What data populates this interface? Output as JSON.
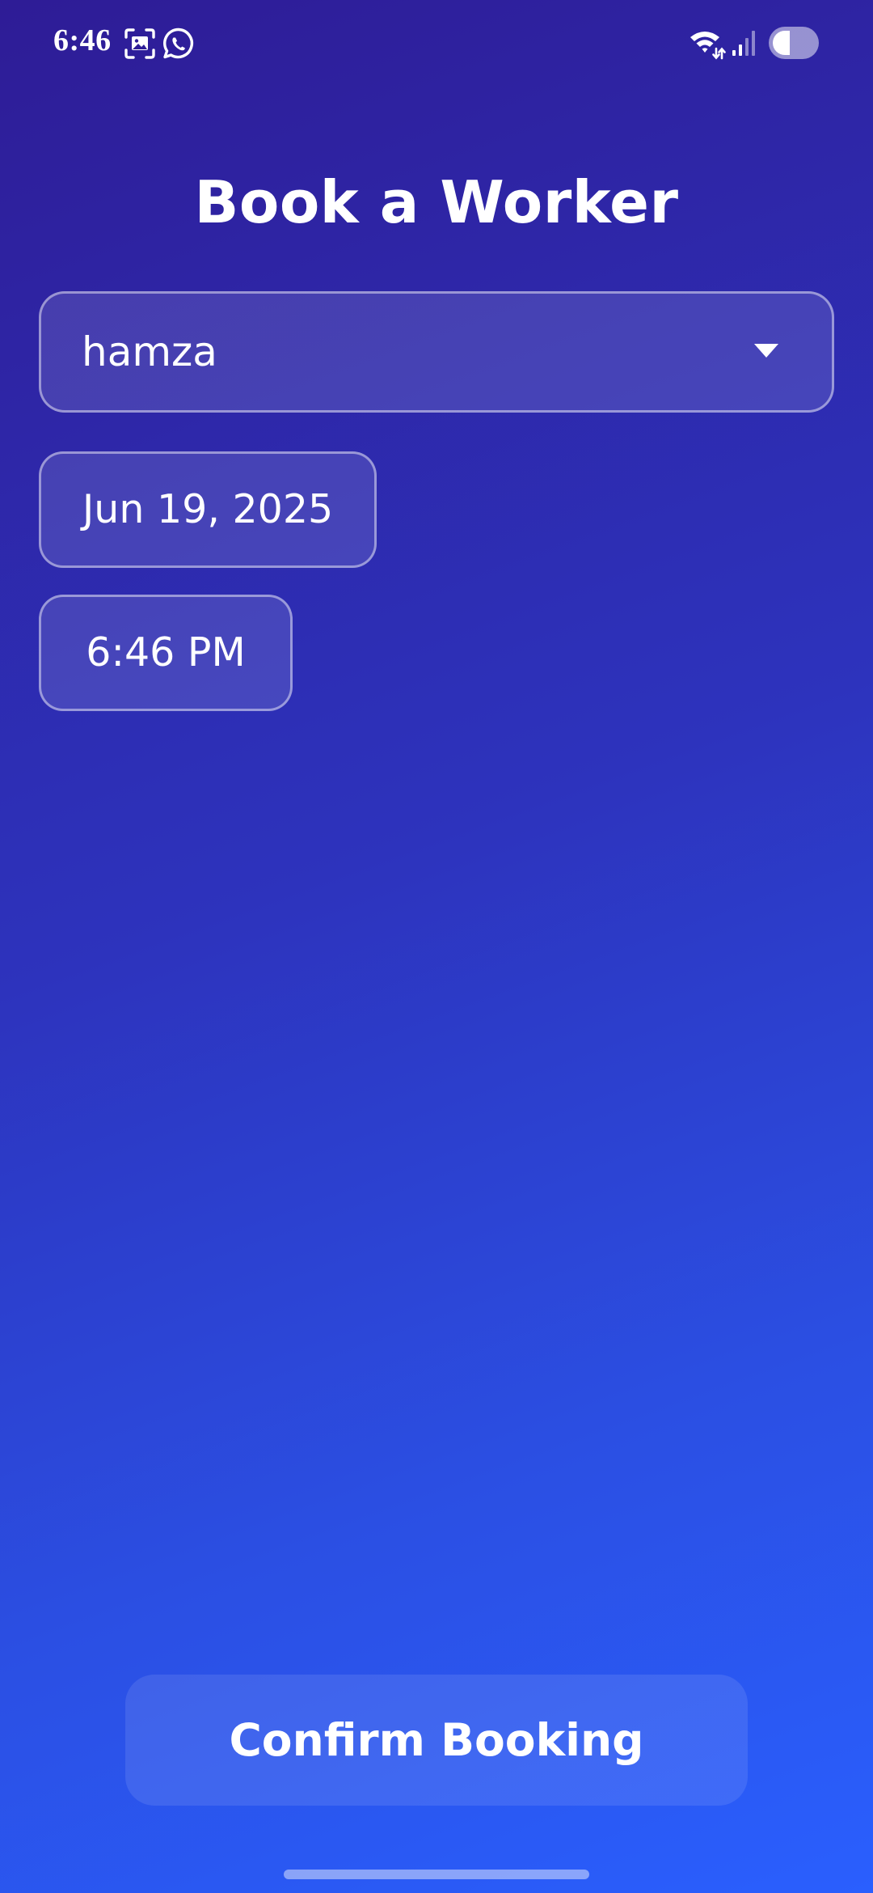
{
  "status_bar": {
    "time": "6:46",
    "icons": [
      "screenshot-icon",
      "whatsapp-icon",
      "wifi-icon",
      "signal-icon",
      "battery-icon"
    ]
  },
  "page": {
    "title": "Book a Worker"
  },
  "form": {
    "worker_select_value": "hamza",
    "date_label": "Jun 19, 2025",
    "time_label": "6:46 PM"
  },
  "actions": {
    "confirm_label": "Confirm Booking"
  },
  "colors": {
    "gradient_top": "#2e1c96",
    "gradient_bottom": "#2a5ffe",
    "text": "#ffffff"
  }
}
